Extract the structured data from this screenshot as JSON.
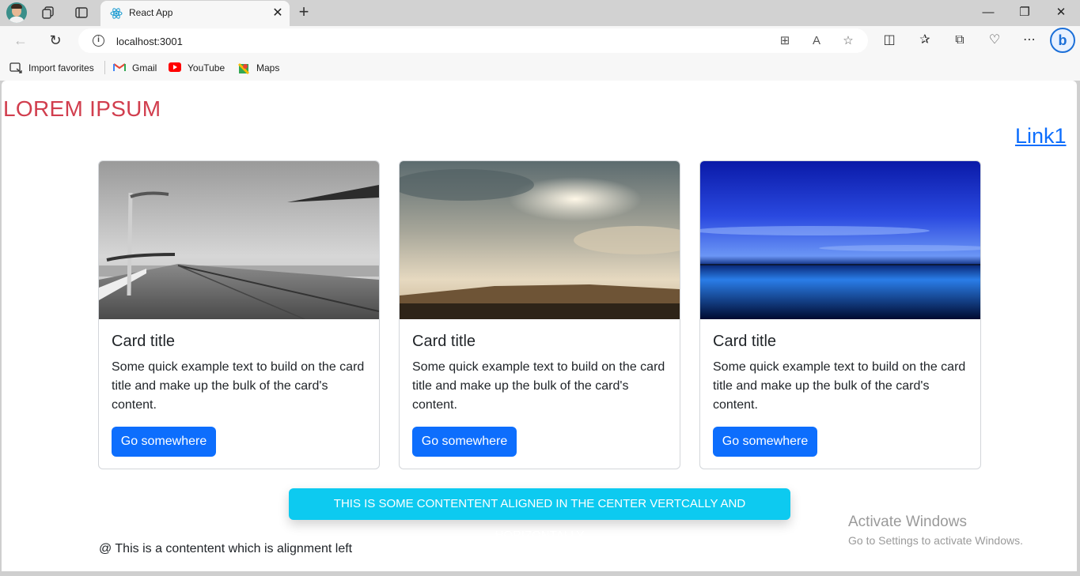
{
  "browser": {
    "tab_title": "React App",
    "tab_close": "✕",
    "new_tab": "+",
    "url": "localhost:3001",
    "window_controls": {
      "minimize": "—",
      "restore": "❐",
      "close": "✕"
    },
    "favorites": [
      {
        "label": "Import favorites",
        "icon": "import-icon"
      },
      {
        "label": "Gmail",
        "icon": "gmail-icon"
      },
      {
        "label": "YouTube",
        "icon": "youtube-icon"
      },
      {
        "label": "Maps",
        "icon": "maps-icon"
      }
    ],
    "bing_label": "b"
  },
  "page": {
    "title": "LOREM IPSUM",
    "link": "Link1",
    "cards": [
      {
        "title": "Card title",
        "text": "Some quick example text to build on the card title and make up the bulk of the card's content.",
        "button": "Go somewhere",
        "image": "pier-grayscale"
      },
      {
        "title": "Card title",
        "text": "Some quick example text to build on the card title and make up the bulk of the card's content.",
        "button": "Go somewhere",
        "image": "cloudy-sunset"
      },
      {
        "title": "Card title",
        "text": "Some quick example text to build on the card title and make up the bulk of the card's content.",
        "button": "Go somewhere",
        "image": "blue-horizon"
      }
    ],
    "center_banner": "THIS IS SOME CONTENTENT ALIGNED IN THE CENTER VERTCALLY AND HORIZONTALLY",
    "left_text": "@ This is a contentent which is alignment left"
  },
  "overlay": {
    "activate_title": "Activate Windows",
    "activate_sub": "Go to Settings to activate Windows."
  },
  "colors": {
    "title_red": "#d13e4e",
    "primary": "#0d6efd",
    "info": "#0dcaf0"
  }
}
